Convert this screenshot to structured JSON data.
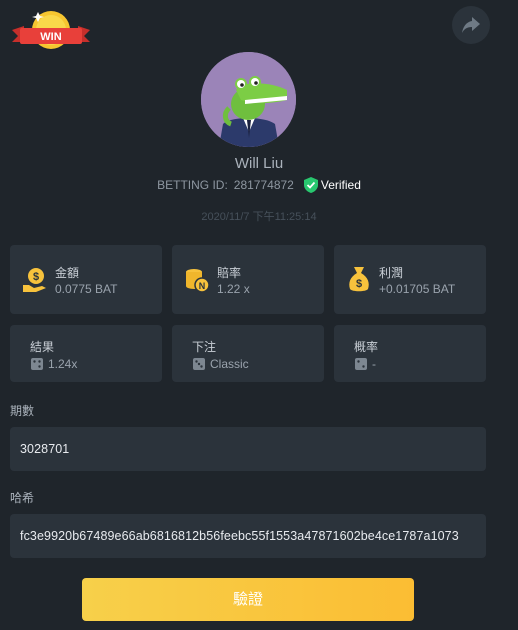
{
  "header": {
    "badge_text": "WIN",
    "share_icon": "share-arrow-icon"
  },
  "profile": {
    "name": "Will Liu",
    "betting_id_label": "BETTING ID:",
    "betting_id": "281774872",
    "verified_label": "Verified",
    "timestamp": "2020/11/7 下午11:25:14",
    "avatar_icon": "crocodile-avatar"
  },
  "stats": {
    "amount": {
      "label": "金額",
      "value": "0.0775 BAT",
      "icon": "coin-hand-icon"
    },
    "odds": {
      "label": "賠率",
      "value": "1.22 x",
      "icon": "coin-stack-icon"
    },
    "profit": {
      "label": "利潤",
      "value": "+0.01705 BAT",
      "icon": "money-bag-icon"
    },
    "result": {
      "label": "結果",
      "value": "1.24x",
      "icon": "dice-icon"
    },
    "bet": {
      "label": "下注",
      "value": "Classic",
      "icon": "dice-icon"
    },
    "probability": {
      "label": "概率",
      "value": "-",
      "icon": "dice-icon"
    }
  },
  "fields": {
    "period_label": "期數",
    "period_value": "3028701",
    "hash_label": "哈希",
    "hash_value": "fc3e9920b67489e66ab6816812b56feebc55f1553a47871602be4ce1787a1073"
  },
  "actions": {
    "verify_label": "驗證"
  },
  "colors": {
    "background": "#1f252b",
    "card": "#2b333b",
    "accent_yellow": "#f9c43f",
    "verified_green": "#28c76f",
    "badge_red": "#e8403a"
  }
}
